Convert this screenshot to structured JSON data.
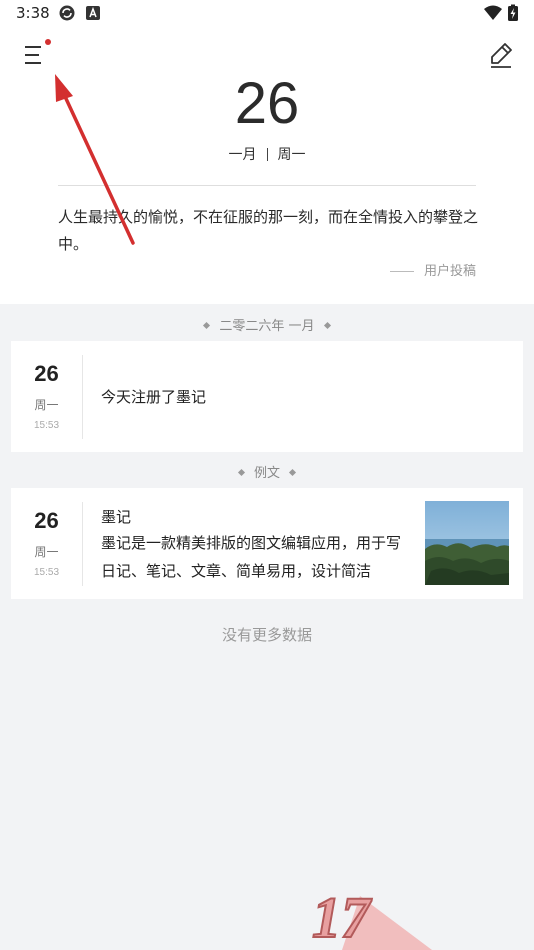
{
  "status_bar": {
    "time": "3:38",
    "icons": [
      "sync-icon",
      "app-badge-icon",
      "wifi-icon",
      "battery-charging-icon"
    ]
  },
  "header": {
    "menu_icon": "menu-icon",
    "notification_dot_color": "#d32f2f",
    "edit_icon": "pencil-icon",
    "day": "26",
    "month": "一月",
    "weekday": "周一",
    "quote": "人生最持久的愉悦，不在征服的那一刻，而在全情投入的攀登之中。",
    "quote_source": "用户投稿"
  },
  "sections": [
    {
      "label": "二零二六年 一月",
      "entry": {
        "day": "26",
        "weekday": "周一",
        "time": "15:53",
        "text": "今天注册了墨记"
      }
    },
    {
      "label": "例文",
      "entry": {
        "day": "26",
        "weekday": "周一",
        "time": "15:53",
        "title": "墨记",
        "body": "墨记是一款精美排版的图文编辑应用，用于写日记、笔记、文章、简单易用，设计简洁",
        "image": "coastal-landscape-photo"
      }
    }
  ],
  "footer_text": "没有更多数据",
  "annotation": {
    "arrow_color": "#d32f2f",
    "watermark_text": "17"
  }
}
